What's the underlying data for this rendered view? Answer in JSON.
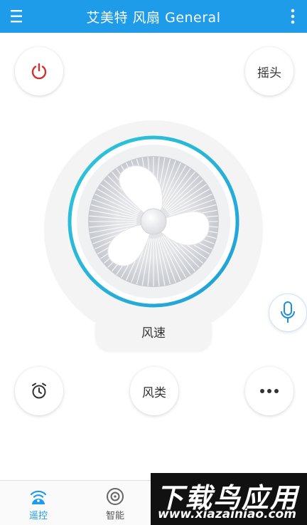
{
  "header": {
    "title": "艾美特 风扇 General",
    "menu_icon": "hamburger-menu-icon",
    "more_icon": "vertical-dots-icon",
    "background": "#1e9be9"
  },
  "controls": {
    "power_icon": "power-icon",
    "power_color": "#d0312d",
    "swing_label": "摇头",
    "speed_label": "风速",
    "timer_icon": "alarm-clock-icon",
    "mode_label": "风类",
    "more_icon": "horizontal-dots-icon",
    "mic_icon": "microphone-icon",
    "ring_color": "#27b6d6"
  },
  "tabs": [
    {
      "label": "遥控",
      "icon": "remote-wifi-icon",
      "active": true
    },
    {
      "label": "智能",
      "icon": "smart-target-icon",
      "active": false
    }
  ],
  "watermark": {
    "title": "下载鸟应用",
    "url": "www.xiazainiao.com"
  }
}
